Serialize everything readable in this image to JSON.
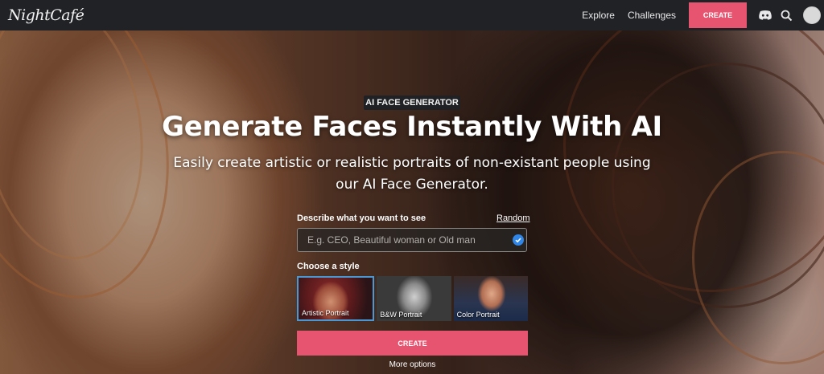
{
  "header": {
    "logo_text": "NightCafé",
    "nav": {
      "explore": "Explore",
      "challenges": "Challenges",
      "create": "CREATE"
    },
    "icons": [
      "discord-icon",
      "search-icon",
      "avatar"
    ]
  },
  "hero": {
    "badge": "AI FACE GENERATOR",
    "title": "Generate Faces Instantly With AI",
    "subtitle": "Easily create artistic or realistic portraits of non-existant people using our AI Face Generator."
  },
  "form": {
    "prompt_label": "Describe what you want to see",
    "random_label": "Random",
    "prompt_placeholder": "E.g. CEO, Beautiful woman or Old man",
    "style_label": "Choose a style",
    "styles": [
      {
        "label": "Artistic Portrait",
        "selected": true
      },
      {
        "label": "B&W Portrait",
        "selected": false
      },
      {
        "label": "Color Portrait",
        "selected": false
      }
    ],
    "create_label": "CREATE",
    "more_options": "More options"
  },
  "colors": {
    "accent": "#e6546f",
    "topbar": "#212226",
    "selected_border": "#4a97d6"
  }
}
